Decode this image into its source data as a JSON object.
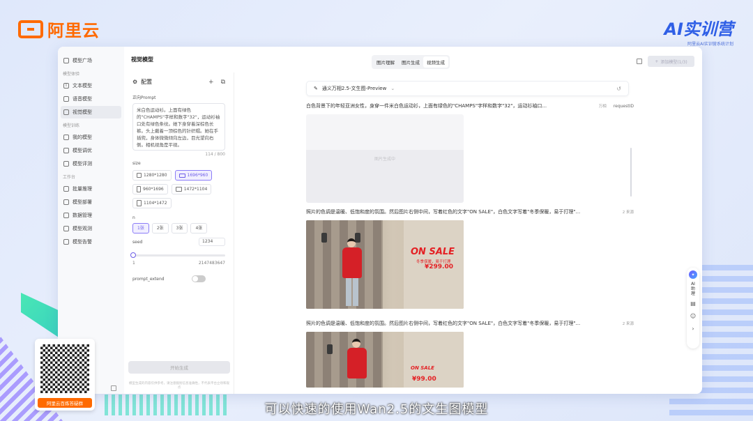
{
  "brand": {
    "name": "阿里云"
  },
  "campaign": {
    "title": "AI实训营",
    "tagline": "阿里云AI实训营系统计划"
  },
  "sidebar": {
    "items": [
      {
        "label": "模型广场",
        "icon": "grid-icon"
      },
      {
        "group": "模型体验"
      },
      {
        "label": "文本模型",
        "icon": "text-icon"
      },
      {
        "label": "语音模型",
        "icon": "voice-icon"
      },
      {
        "label": "视觉模型",
        "icon": "vision-icon",
        "active": true
      },
      {
        "group": "模型训练"
      },
      {
        "label": "我的模型",
        "icon": "model-icon"
      },
      {
        "label": "模型调优",
        "icon": "tune-icon"
      },
      {
        "label": "模型评测",
        "icon": "eval-icon"
      },
      {
        "group": "工作台"
      },
      {
        "label": "批量推理",
        "icon": "batch-icon"
      },
      {
        "label": "模型部署",
        "icon": "deploy-icon"
      },
      {
        "label": "数据管理",
        "icon": "data-icon"
      },
      {
        "label": "模型观测",
        "icon": "observe-icon"
      },
      {
        "label": "模型告警",
        "icon": "alert-icon"
      }
    ]
  },
  "header": {
    "title": "视觉模型",
    "tabs": [
      {
        "label": "图片理解"
      },
      {
        "label": "图片生成"
      },
      {
        "label": "视频生成"
      }
    ],
    "add_label": "添加模型(1/3)"
  },
  "config": {
    "title": "配置",
    "prompt_label": "正向Prompt",
    "prompt_text": "米白色运动衫。上面有绿色的\"CHAMPS\"字样和数字\"32\"，运动衫袖口处有绿色条纹。她下身穿着深棕色长裤。头上戴着一顶棕色的针织帽。她在手插兜，身体微微倾向左边，目光望向右侧。相机视角是平视。",
    "counter": "114 / 800",
    "size_label": "size",
    "sizes": [
      "1280*1280",
      "1696*960",
      "960*1696",
      "1472*1104",
      "1104*1472"
    ],
    "selected_size": "1696*960",
    "n_label": "n",
    "n_options": [
      "1张",
      "2张",
      "3张",
      "4张"
    ],
    "selected_n": "1张",
    "seed_label": "seed",
    "seed_value": "1234",
    "seed_min": "1",
    "seed_max": "2147483647",
    "extend_label": "prompt_extend",
    "generate_label": "开始生成",
    "note": "模型生成的内容仅供参考，请注意甄别信息准确性，不代表平台立场和观点"
  },
  "main": {
    "model_name": "通义万相2.5-文生图-Preview",
    "results": [
      {
        "prompt": "白色背景下的年轻亚洲女性，身穿一件米白色运动衫，上面有绿色的\"CHAMPS\"字样和数字\"32\"，运动衫袖口...",
        "meta": "万相",
        "request": "requestID",
        "placeholder": "图片生成中"
      },
      {
        "prompt": "照片的色调是温暖、低饱和度的氛围。然后图片右侧中间，写着红色的文字\"ON SALE\"，白色文字写着\"冬季保暖，易于打理\"...",
        "meta": "2 来源",
        "sign": "ON SALE",
        "sub": "冬季保暖，易于打理",
        "price": "¥299.00"
      },
      {
        "prompt": "照片的色调是温暖、低饱和度的氛围。然后图片右侧中间，写着红色的文字\"ON SALE\"，白色文字写着\"冬季保暖，易于打理\"...",
        "meta": "2 来源",
        "sign": "ON SALE",
        "price": "¥99.00"
      }
    ]
  },
  "rail": {
    "ai_label": "AI助理"
  },
  "qr": {
    "caption": "阿里云百炼答疑群"
  },
  "subtitle": "可以快速的使用Wan2.5的文生图模型"
}
